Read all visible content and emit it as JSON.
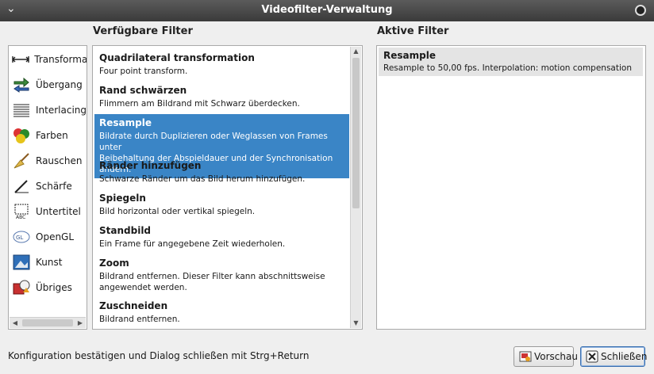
{
  "window": {
    "title": "Videofilter-Verwaltung"
  },
  "headings": {
    "available": "Verfügbare Filter",
    "active": "Aktive Filter"
  },
  "categories": [
    {
      "label": "Transformat",
      "icon": "transform-arrows-icon"
    },
    {
      "label": "Übergang",
      "icon": "transition-arrows-icon"
    },
    {
      "label": "Interlacing",
      "icon": "interlacing-lines-icon"
    },
    {
      "label": "Farben",
      "icon": "color-balls-icon"
    },
    {
      "label": "Rauschen",
      "icon": "broom-icon"
    },
    {
      "label": "Schärfe",
      "icon": "pen-sharpen-icon"
    },
    {
      "label": "Untertitel",
      "icon": "subtitle-abc-icon"
    },
    {
      "label": "OpenGL",
      "icon": "opengl-logo-icon"
    },
    {
      "label": "Kunst",
      "icon": "art-picture-icon"
    },
    {
      "label": "Übriges",
      "icon": "misc-icon"
    }
  ],
  "filters": [
    {
      "name": "Quadrilateral transformation",
      "desc": [
        "Four point transform."
      ]
    },
    {
      "name": "Rand schwärzen",
      "desc": [
        "Flimmern am Bildrand mit Schwarz überdecken."
      ]
    },
    {
      "name": "Resample",
      "desc": [
        "Bildrate durch Duplizieren oder Weglassen von Frames unter",
        "Beibehaltung der Abspieldauer und der Synchronisation ändern."
      ],
      "selected": true
    },
    {
      "name": "Ränder hinzufügen",
      "desc": [
        "Schwarze Ränder um das Bild herum hinzufügen."
      ]
    },
    {
      "name": "Spiegeln",
      "desc": [
        "Bild horizontal oder vertikal spiegeln."
      ]
    },
    {
      "name": "Standbild",
      "desc": [
        "Ein Frame für angegebene Zeit wiederholen."
      ]
    },
    {
      "name": "Zoom",
      "desc": [
        "Bildrand entfernen. Dieser Filter kann abschnittsweise",
        "angewendet werden."
      ]
    },
    {
      "name": "Zuschneiden",
      "desc": [
        "Bildrand entfernen."
      ]
    }
  ],
  "active_filters": [
    {
      "name": "Resample",
      "desc": "Resample to 50,00 fps. Interpolation: motion compensation"
    }
  ],
  "status": "Konfiguration bestätigen und Dialog schließen mit Strg+Return",
  "buttons": {
    "preview": "Vorschau",
    "close": "Schließen"
  },
  "colors": {
    "selection": "#3a85c6",
    "titlebar": "#4a4a4a"
  }
}
